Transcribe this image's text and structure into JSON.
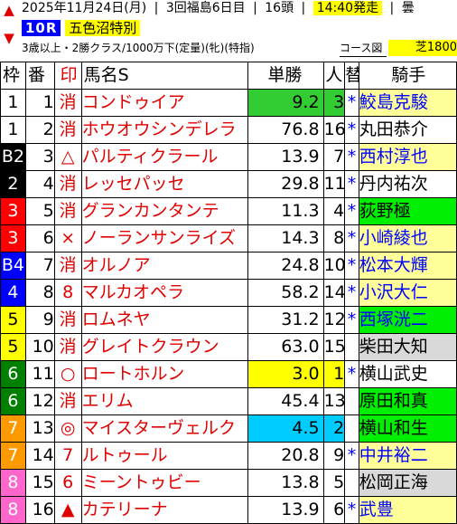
{
  "header": {
    "date_text": "2025年11月24日(月)",
    "meeting_text": "3回福島6日目",
    "runners_text": "16頭",
    "post_time": "14:40発走",
    "weather_text": "曇",
    "race_number": "10R",
    "race_name": "五色沼特別",
    "conditions": "3歳以上・2勝クラス/1000万下(定量)(牝)(特指)",
    "course_link": "コース図",
    "surface_text": "芝1800"
  },
  "columns": {
    "waku": "枠",
    "umaban": "番",
    "mark": "印",
    "name": "馬名S",
    "odds": "単勝",
    "ninki": "人",
    "change": "替",
    "jockey": "騎手"
  },
  "rows": [
    {
      "waku": "1",
      "umaban": "1",
      "mark": "消",
      "name": "コンドゥイア",
      "odds": "9.2",
      "ninki": "3",
      "change": "*",
      "jockey": "鮫島克駿",
      "waku_bg": "#ffffff",
      "waku_fg": "#000000",
      "odds_bg": "#33cc33",
      "ninki_bg": "#33cc33",
      "jockey_bg": "#ffff99",
      "jockey_fg": "#0000ff"
    },
    {
      "waku": "1",
      "umaban": "2",
      "mark": "消",
      "name": "ホウオウシンデレラ",
      "odds": "76.8",
      "ninki": "16",
      "change": "*",
      "jockey": "丸田恭介",
      "waku_bg": "#ffffff",
      "waku_fg": "#000000",
      "odds_bg": "#ffffff",
      "ninki_bg": "#ffffff",
      "jockey_bg": "#ffffff",
      "jockey_fg": "#000000"
    },
    {
      "waku": "B2",
      "umaban": "3",
      "mark": "△",
      "name": "パルティクラール",
      "odds": "13.9",
      "ninki": "7",
      "change": "*",
      "jockey": "西村淳也",
      "waku_bg": "#000000",
      "waku_fg": "#ffffff",
      "odds_bg": "#ffffff",
      "ninki_bg": "#ffffff",
      "jockey_bg": "#ffff99",
      "jockey_fg": "#0000ff"
    },
    {
      "waku": "2",
      "umaban": "4",
      "mark": "消",
      "name": "レッセパッセ",
      "odds": "29.8",
      "ninki": "11",
      "change": "*",
      "jockey": "丹内祐次",
      "waku_bg": "#000000",
      "waku_fg": "#ffffff",
      "odds_bg": "#ffffff",
      "ninki_bg": "#ffffff",
      "jockey_bg": "#ffffff",
      "jockey_fg": "#000000"
    },
    {
      "waku": "3",
      "umaban": "5",
      "mark": "消",
      "name": "グランカンタンテ",
      "odds": "11.3",
      "ninki": "4",
      "change": "*",
      "jockey": "荻野極",
      "waku_bg": "#ff0000",
      "waku_fg": "#ffffff",
      "odds_bg": "#ffffff",
      "ninki_bg": "#ffffff",
      "jockey_bg": "#00ee00",
      "jockey_fg": "#000000"
    },
    {
      "waku": "3",
      "umaban": "6",
      "mark": "×",
      "name": "ノーランサンライズ",
      "odds": "14.3",
      "ninki": "8",
      "change": "*",
      "jockey": "小崎綾也",
      "waku_bg": "#ff0000",
      "waku_fg": "#ffffff",
      "odds_bg": "#ffffff",
      "ninki_bg": "#ffffff",
      "jockey_bg": "#ffff99",
      "jockey_fg": "#0000ff"
    },
    {
      "waku": "B4",
      "umaban": "7",
      "mark": "消",
      "name": "オルノア",
      "odds": "24.8",
      "ninki": "10",
      "change": "*",
      "jockey": "松本大輝",
      "waku_bg": "#0000ff",
      "waku_fg": "#ffffff",
      "odds_bg": "#ffffff",
      "ninki_bg": "#ffffff",
      "jockey_bg": "#ffff99",
      "jockey_fg": "#0000ff"
    },
    {
      "waku": "4",
      "umaban": "8",
      "mark": "8",
      "name": "マルカオペラ",
      "odds": "58.2",
      "ninki": "14",
      "change": "*",
      "jockey": "小沢大仁",
      "waku_bg": "#0000ff",
      "waku_fg": "#ffffff",
      "odds_bg": "#ffffff",
      "ninki_bg": "#ffffff",
      "jockey_bg": "#ffff99",
      "jockey_fg": "#0000ff"
    },
    {
      "waku": "5",
      "umaban": "9",
      "mark": "消",
      "name": "ロムネヤ",
      "odds": "31.2",
      "ninki": "12",
      "change": "*",
      "jockey": "西塚洸二",
      "waku_bg": "#ffff00",
      "waku_fg": "#000000",
      "odds_bg": "#ffffff",
      "ninki_bg": "#ffffff",
      "jockey_bg": "#00ee00",
      "jockey_fg": "#0000ff"
    },
    {
      "waku": "5",
      "umaban": "10",
      "mark": "消",
      "name": "グレイトクラウン",
      "odds": "63.0",
      "ninki": "15",
      "change": "",
      "jockey": "柴田大知",
      "waku_bg": "#ffff00",
      "waku_fg": "#000000",
      "odds_bg": "#ffffff",
      "ninki_bg": "#ffffff",
      "jockey_bg": "#d9d9d9",
      "jockey_fg": "#000000"
    },
    {
      "waku": "6",
      "umaban": "11",
      "mark": "○",
      "name": "ロートホルン",
      "odds": "3.0",
      "ninki": "1",
      "change": "*",
      "jockey": "横山武史",
      "waku_bg": "#008000",
      "waku_fg": "#ffffff",
      "odds_bg": "#ffff00",
      "ninki_bg": "#ffff00",
      "jockey_bg": "#ffffff",
      "jockey_fg": "#000000"
    },
    {
      "waku": "6",
      "umaban": "12",
      "mark": "消",
      "name": "エリム",
      "odds": "45.4",
      "ninki": "13",
      "change": "",
      "jockey": "原田和真",
      "waku_bg": "#008000",
      "waku_fg": "#ffffff",
      "odds_bg": "#ffffff",
      "ninki_bg": "#ffffff",
      "jockey_bg": "#00ee00",
      "jockey_fg": "#000000"
    },
    {
      "waku": "7",
      "umaban": "13",
      "mark": "◎",
      "name": "マイスターヴェルク",
      "odds": "4.5",
      "ninki": "2",
      "change": "",
      "jockey": "横山和生",
      "waku_bg": "#ff9900",
      "waku_fg": "#ffffff",
      "odds_bg": "#00ccff",
      "ninki_bg": "#00ccff",
      "jockey_bg": "#00ee00",
      "jockey_fg": "#000000"
    },
    {
      "waku": "7",
      "umaban": "14",
      "mark": "7",
      "name": "ルトゥール",
      "odds": "20.8",
      "ninki": "9",
      "change": "*",
      "jockey": "中井裕二",
      "waku_bg": "#ff9900",
      "waku_fg": "#ffffff",
      "odds_bg": "#ffffff",
      "ninki_bg": "#ffffff",
      "jockey_bg": "#ffff99",
      "jockey_fg": "#0000ff"
    },
    {
      "waku": "8",
      "umaban": "15",
      "mark": "6",
      "name": "ミーントゥビー",
      "odds": "13.8",
      "ninki": "5",
      "change": "",
      "jockey": "松岡正海",
      "waku_bg": "#ff66cc",
      "waku_fg": "#ffffff",
      "odds_bg": "#ffffff",
      "ninki_bg": "#ffffff",
      "jockey_bg": "#d9d9d9",
      "jockey_fg": "#000000"
    },
    {
      "waku": "8",
      "umaban": "16",
      "mark": "▲",
      "name": "カテリーナ",
      "odds": "13.9",
      "ninki": "6",
      "change": "*",
      "jockey": "武豊",
      "waku_bg": "#ff66cc",
      "waku_fg": "#ffffff",
      "odds_bg": "#ffffff",
      "ninki_bg": "#ffffff",
      "jockey_bg": "#ffff99",
      "jockey_fg": "#0000ff"
    }
  ]
}
